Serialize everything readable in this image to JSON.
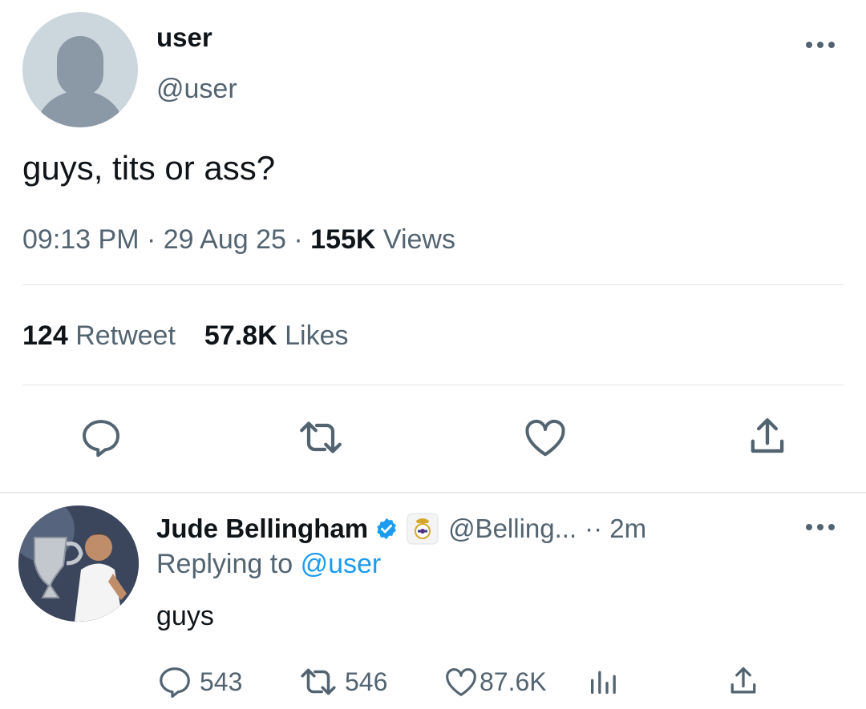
{
  "tweet": {
    "author": {
      "name": "user",
      "handle": "@user"
    },
    "text": "guys, tits or ass?",
    "time": "09:13 PM",
    "date": "29 Aug 25",
    "views_count": "155K",
    "views_label": "Views",
    "retweets_count": "124",
    "retweets_label": "Retweet",
    "likes_count": "57.8K",
    "likes_label": "Likes",
    "actions": {
      "reply_icon": "reply-icon",
      "retweet_icon": "retweet-icon",
      "like_icon": "heart-icon",
      "share_icon": "share-icon"
    }
  },
  "reply": {
    "author": {
      "name": "Jude Bellingham",
      "handle": "@Belling...",
      "verified": true,
      "badge_icon": "real-madrid-crest-icon"
    },
    "time": "2m",
    "replying_label": "Replying to",
    "replying_to": "@user",
    "text": "guys",
    "reply_count": "543",
    "retweet_count": "546",
    "like_count": "87.6K"
  },
  "colors": {
    "text": "#0f1419",
    "secondary": "#536471",
    "accent": "#1d9bf0",
    "divider": "#e1e6ea",
    "avatar_placeholder": "#ccd6dd"
  }
}
